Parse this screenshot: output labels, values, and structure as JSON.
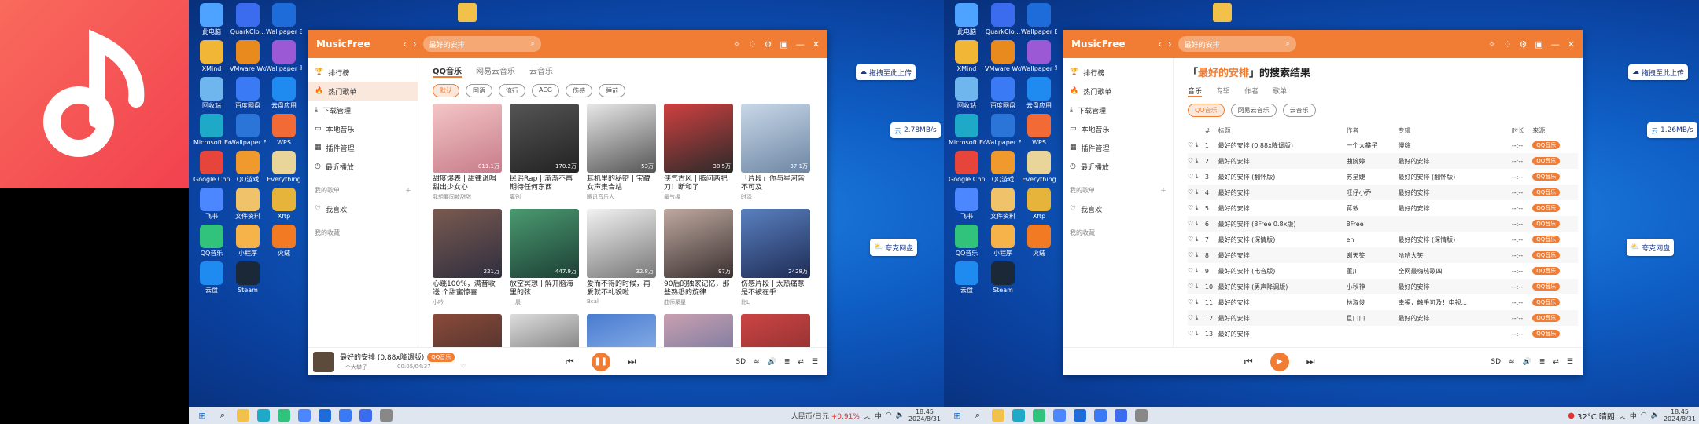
{
  "colors": {
    "accent": "#f17d34",
    "logo_bg": "#f2414f"
  },
  "desktop_icons": [
    {
      "label": "此电脑",
      "color": "#4da3ff"
    },
    {
      "label": "QuarkClo...",
      "color": "#3b6cf0"
    },
    {
      "label": "Wallpaper Engine",
      "color": "#1e6cd9"
    },
    {
      "label": "XMind",
      "color": "#f2b636"
    },
    {
      "label": "VMware Workstati...",
      "color": "#e88a1e"
    },
    {
      "label": "Wallpaper 写文",
      "color": "#9b59d6"
    },
    {
      "label": "回收站",
      "color": "#6fb6ef"
    },
    {
      "label": "百度网盘",
      "color": "#3a7bf5"
    },
    {
      "label": "云盘应用",
      "color": "#1f8bf0"
    },
    {
      "label": "Microsoft Edge",
      "color": "#1fa9c8"
    },
    {
      "label": "Wallpaper Engine",
      "color": "#2b74d8"
    },
    {
      "label": "WPS",
      "color": "#f26b36"
    },
    {
      "label": "Google Chrome",
      "color": "#e7453b"
    },
    {
      "label": "QQ游戏",
      "color": "#f09a2d"
    },
    {
      "label": "Everything",
      "color": "#e9d59a"
    },
    {
      "label": "飞书",
      "color": "#4c87ff"
    },
    {
      "label": "文件资料",
      "color": "#f0c26a"
    },
    {
      "label": "Xftp",
      "color": "#e6b43a"
    },
    {
      "label": "QQ音乐",
      "color": "#31c27c"
    },
    {
      "label": "小程序",
      "color": "#f6b34a"
    },
    {
      "label": "火绒",
      "color": "#f27a22"
    },
    {
      "label": "云盘",
      "color": "#1f8bf0"
    },
    {
      "label": "Steam",
      "color": "#1b2838"
    }
  ],
  "folder_label": "",
  "float": {
    "upload": "拖拽至此上传",
    "speed_left": "2.78MB/s",
    "speed_right": "1.26MB/s",
    "quark": "夸克网盘"
  },
  "app": {
    "brand": "MusicFree",
    "search_value": "最好的安排"
  },
  "sidebar": {
    "items": [
      "排行榜",
      "热门歌单",
      "下载管理",
      "本地音乐",
      "插件管理",
      "最近播放"
    ],
    "my_sheets": "我的歌单",
    "favorite": "我喜欢",
    "my_collect": "我的收藏"
  },
  "hot": {
    "tabs": [
      "QQ音乐",
      "网易云音乐",
      "云音乐"
    ],
    "chips": [
      "默认",
      "国语",
      "流行",
      "ACG",
      "伤感",
      "睡前"
    ],
    "cards": [
      {
        "title": "甜度爆表 | 甜律说唱 甜出少女心",
        "author": "我想要同款甜甜",
        "count": "811.1万",
        "c1": "#f4c6c6",
        "c2": "#c77b8a"
      },
      {
        "title": "民谣Rap | 渐渐不再 期待任何东西",
        "author": "离别",
        "count": "170.2万",
        "c1": "#555",
        "c2": "#222"
      },
      {
        "title": "耳机里的秘密 | 宝藏女声集合站",
        "author": "腾讯音乐人",
        "count": "53万",
        "c1": "#e8e8e8",
        "c2": "#555"
      },
      {
        "title": "侠气古风 | 腾问两肥 刀！断和了",
        "author": "氟气缘",
        "count": "38.5万",
        "c1": "#d04040",
        "c2": "#2a2a2a"
      },
      {
        "title": "「片段」你与星河皆 不可及",
        "author": "时泽",
        "count": "37.1万",
        "c1": "#c9d8e8",
        "c2": "#6d86a4"
      },
      {
        "title": "心跳100%，满音收送 个甜蜜惊喜",
        "author": "小吟",
        "count": "221万",
        "c1": "#7a5a50",
        "c2": "#2f2e3f"
      },
      {
        "title": "放空冥想 | 解开脑海 里的弦",
        "author": "一晨",
        "count": "447.9万",
        "c1": "#4a9a70",
        "c2": "#1d3f35"
      },
      {
        "title": "爱而不得的时候，再 爱就不礼貌啦",
        "author": "Bcal",
        "count": "32.8万",
        "c1": "#f2f2f2",
        "c2": "#777"
      },
      {
        "title": "90后的独家记忆，那 些熟悉的旋律",
        "author": "曲师聚星",
        "count": "97万",
        "c1": "#bfa9a0",
        "c2": "#3a3030"
      },
      {
        "title": "伤感片段 | 太热痛意 是不被在乎",
        "author": "比L",
        "count": "2428万",
        "c1": "#5a80c0",
        "c2": "#1e2c55"
      },
      {
        "title": "",
        "author": "",
        "count": "",
        "c1": "#8a4a3a",
        "c2": "#3a2a2a"
      },
      {
        "title": "",
        "author": "",
        "count": "",
        "c1": "#ddd",
        "c2": "#555"
      },
      {
        "title": "",
        "author": "",
        "count": "",
        "c1": "#4a7bd0",
        "c2": "#a0c4f0"
      },
      {
        "title": "",
        "author": "",
        "count": "",
        "c1": "#c9a0b0",
        "c2": "#5a6a9a"
      },
      {
        "title": "",
        "author": "",
        "count": "",
        "c1": "#c44",
        "c2": "#7a2a2a"
      }
    ]
  },
  "player_left": {
    "title": "最好的安排 (0.88x降调版)",
    "tag": "QQ音乐",
    "artist": "一个大攀子",
    "time": "00:05/04:37"
  },
  "player_icons": [
    "SD",
    "≋",
    "🔊",
    "≣",
    "⇄",
    "☰"
  ],
  "results": {
    "title_pre": "「",
    "keyword": "最好的安排",
    "title_post": "」的搜索结果",
    "tabs": [
      "音乐",
      "专辑",
      "作者",
      "歌单"
    ],
    "chips": [
      "QQ音乐",
      "网易云音乐",
      "云音乐"
    ],
    "columns": [
      "#",
      "标题",
      "作者",
      "专辑",
      "时长",
      "来源"
    ],
    "rows": [
      {
        "n": "1",
        "title": "最好的安排 (0.88x降调版)",
        "artist": "一个大攀子",
        "album": "慢嗨",
        "dur": "--:--",
        "src": "QQ音乐"
      },
      {
        "n": "2",
        "title": "最好的安排",
        "artist": "曲婉婷",
        "album": "最好的安排",
        "dur": "--:--",
        "src": "QQ音乐"
      },
      {
        "n": "3",
        "title": "最好的安排 (翻怀版)",
        "artist": "苏星婕",
        "album": "最好的安排 (翻怀版)",
        "dur": "--:--",
        "src": "QQ音乐"
      },
      {
        "n": "4",
        "title": "最好的安排",
        "artist": "旺仔小乔",
        "album": "最好的安排",
        "dur": "--:--",
        "src": "QQ音乐"
      },
      {
        "n": "5",
        "title": "最好的安排",
        "artist": "蒋敦",
        "album": "最好的安排",
        "dur": "--:--",
        "src": "QQ音乐"
      },
      {
        "n": "6",
        "title": "最好的安排 (8Free 0.8x版)",
        "artist": "8Free",
        "album": "",
        "dur": "--:--",
        "src": "QQ音乐"
      },
      {
        "n": "7",
        "title": "最好的安排 (深情版)",
        "artist": "en",
        "album": "最好的安排 (深情版)",
        "dur": "--:--",
        "src": "QQ音乐"
      },
      {
        "n": "8",
        "title": "最好的安排",
        "artist": "谢天笑",
        "album": "哈哈大笑",
        "dur": "--:--",
        "src": "QQ音乐"
      },
      {
        "n": "9",
        "title": "最好的安排 (电音版)",
        "artist": "董川",
        "album": "全网最嗨热歌四",
        "dur": "--:--",
        "src": "QQ音乐"
      },
      {
        "n": "10",
        "title": "最好的安排 (男声降调版)",
        "artist": "小秋神",
        "album": "最好的安排",
        "dur": "--:--",
        "src": "QQ音乐"
      },
      {
        "n": "11",
        "title": "最好的安排",
        "artist": "林淑俊",
        "album": "幸福，触手可及！电视...",
        "dur": "--:--",
        "src": "QQ音乐"
      },
      {
        "n": "12",
        "title": "最好的安排",
        "artist": "且口口",
        "album": "最好的安排",
        "dur": "--:--",
        "src": "QQ音乐"
      },
      {
        "n": "13",
        "title": "最好的安排",
        "artist": "",
        "album": "",
        "dur": "--:--",
        "src": "QQ音乐"
      }
    ]
  },
  "taskbar_left": {
    "ticker": "人民币/日元",
    "ticker_change": "+0.91%",
    "ime": "中",
    "time": "18:45",
    "date": "2024/8/31"
  },
  "taskbar_right": {
    "weather": "32°C 晴朗",
    "ime": "中",
    "time": "18:45",
    "date": "2024/8/31"
  }
}
